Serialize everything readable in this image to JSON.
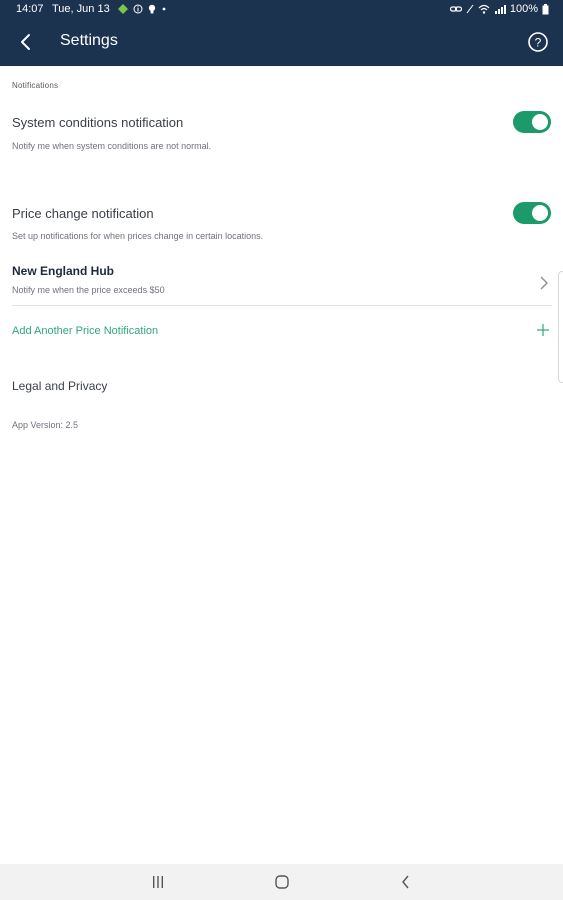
{
  "status_bar": {
    "time": "14:07",
    "date": "Tue, Jun 13",
    "battery": "100%",
    "icons": [
      "android-icon",
      "info-icon",
      "bulb-icon",
      "dot-icon",
      "link-icon",
      "mute-icon",
      "wifi-icon",
      "signal-icon",
      "battery-icon"
    ]
  },
  "app_bar": {
    "title": "Settings",
    "back_icon": "back-arrow-icon",
    "help_icon": "help-icon"
  },
  "notifications": {
    "section_header": "Notifications",
    "system": {
      "title": "System conditions notification",
      "subtitle": "Notify me when system conditions are not normal.",
      "enabled": true
    },
    "price": {
      "title": "Price change notification",
      "subtitle": "Set up notifications for when prices change in certain locations.",
      "enabled": true
    },
    "hub": {
      "title": "New England Hub",
      "subtitle": "Notify me when the price exceeds $50"
    },
    "add_link": "Add Another Price Notification"
  },
  "legal": "Legal and Privacy",
  "version": "App Version: 2.5",
  "colors": {
    "header": "#1c3350",
    "accent": "#1d9a69",
    "link": "#2fa77a"
  },
  "nav_bar": {
    "icons": [
      "recents-icon",
      "home-icon",
      "back-icon"
    ]
  }
}
